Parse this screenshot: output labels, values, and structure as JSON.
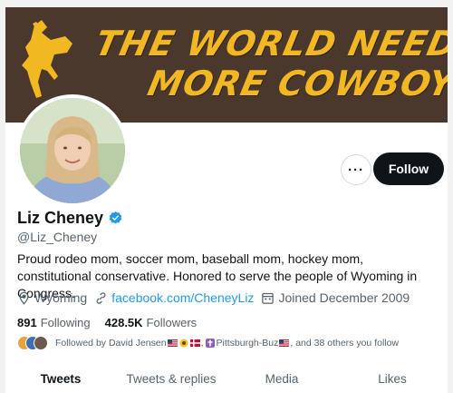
{
  "banner": {
    "line1": "THE WORLD NEEDS",
    "line2": "MORE COWBOYS",
    "colors": {
      "background": "#4a382d",
      "text": "#f2b822"
    }
  },
  "profile": {
    "name": "Liz Cheney",
    "handle": "@Liz_Cheney",
    "bio": "Proud rodeo mom, soccer mom, baseball mom, hockey mom, constitutional conservative. Honored to serve the people of Wyoming in Congress.",
    "location": "Wyoming",
    "website": "facebook.com/CheneyLiz",
    "joined": "Joined December 2009",
    "verified": true
  },
  "actions": {
    "more_label": "···",
    "follow_label": "Follow"
  },
  "counts": {
    "following_value": "891",
    "following_label": "Following",
    "followers_value": "428.5K",
    "followers_label": "Followers"
  },
  "followed_by": {
    "prefix": "Followed by David Jensen",
    "middle": ", ",
    "second": "Pittsburgh-Buz",
    "suffix": ", and 38 others you follow"
  },
  "tabs": [
    {
      "label": "Tweets",
      "active": true
    },
    {
      "label": "Tweets & replies",
      "active": false
    },
    {
      "label": "Media",
      "active": false
    },
    {
      "label": "Likes",
      "active": false
    }
  ],
  "colors": {
    "accent": "#1d9bf0",
    "text_primary": "#0f1419",
    "text_secondary": "#536471"
  }
}
